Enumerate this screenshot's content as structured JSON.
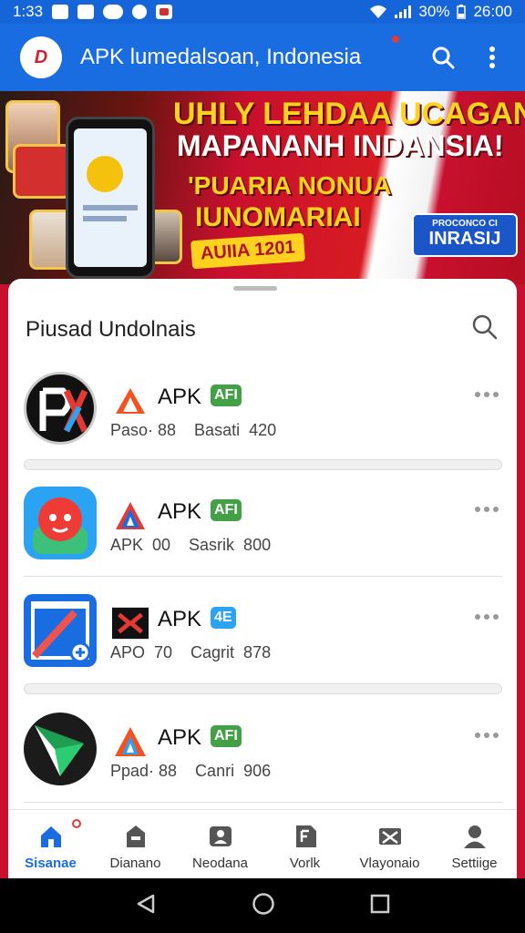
{
  "status_bar": {
    "time": "1:33",
    "battery": "30%",
    "clock": "26:00"
  },
  "app_bar": {
    "logo": "D",
    "title": "APK lumedalsoan, Indonesia"
  },
  "banner": {
    "line1": "UHLY LEHDAA UCAGAN",
    "line2": "MAPANANH INDANSIA!",
    "line3": "'PUARIA NONUA",
    "line4": "IUNOMARIAI",
    "badge": "AUIIA 1201",
    "tag_small": "PROCONCO CI",
    "tag": "INRASIJ"
  },
  "sheet": {
    "title": "Piusad Undolnais",
    "items": [
      {
        "label": "APK",
        "chip": "AFI",
        "meta": "Paso· 88    Basati  420"
      },
      {
        "label": "APK",
        "chip": "AFI",
        "meta": "APK  00    Sasrik  800"
      },
      {
        "label": "APK",
        "chip": "4E",
        "meta": "APO  70    Cagrit  878"
      },
      {
        "label": "APK",
        "chip": "AFI",
        "meta": "Ppad· 88    Canri  906"
      }
    ]
  },
  "bottom_nav": [
    {
      "label": "Sisanae"
    },
    {
      "label": "Dianano"
    },
    {
      "label": "Neodana"
    },
    {
      "label": "Vorlk"
    },
    {
      "label": "Vlayonaio"
    },
    {
      "label": "Settiige"
    }
  ],
  "colors": {
    "primary": "#1a6de0",
    "accent_red": "#c8102e",
    "chip_green": "#43a047",
    "chip_blue": "#29a3f2"
  }
}
